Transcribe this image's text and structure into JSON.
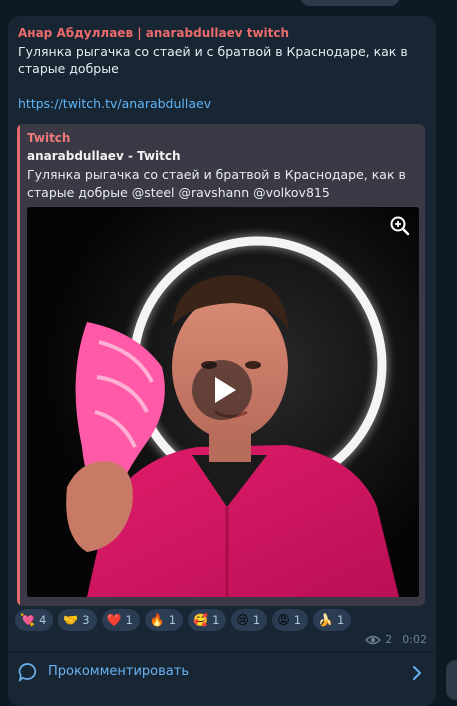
{
  "message": {
    "sender": "Анар Абдуллаев | anarabdullaev twitch",
    "text": "Гулянка рыгачка со стаей и с братвой в Краснодаре, как в старые добрые",
    "link": "https://twitch.tv/anarabdullaev"
  },
  "preview": {
    "site_name": "Twitch",
    "title": "anarabdullaev - Twitch",
    "description": "Гулянка рыгачка со стаей и братвой в Краснодаре, как в старые добрые @steel @ravshann @volkov815",
    "zoom_icon": "zoom-in-icon",
    "play_icon": "play-icon"
  },
  "reactions": [
    {
      "emoji": "💘",
      "count": "4"
    },
    {
      "emoji": "🤝",
      "count": "3"
    },
    {
      "emoji": "❤️",
      "count": "1"
    },
    {
      "emoji": "🔥",
      "count": "1"
    },
    {
      "emoji": "🥰",
      "count": "1"
    },
    {
      "emoji": "😢",
      "count": "1"
    },
    {
      "emoji": "😡",
      "count": "1"
    },
    {
      "emoji": "🍌",
      "count": "1"
    }
  ],
  "meta": {
    "views": "2",
    "time": "0:02"
  },
  "comments": {
    "label": "Прокомментировать"
  },
  "colors": {
    "background": "#0f1924",
    "bubble": "#182533",
    "sender": "#ec6c6c",
    "link": "#5eb5f7",
    "accent": "#6ab3f3"
  }
}
